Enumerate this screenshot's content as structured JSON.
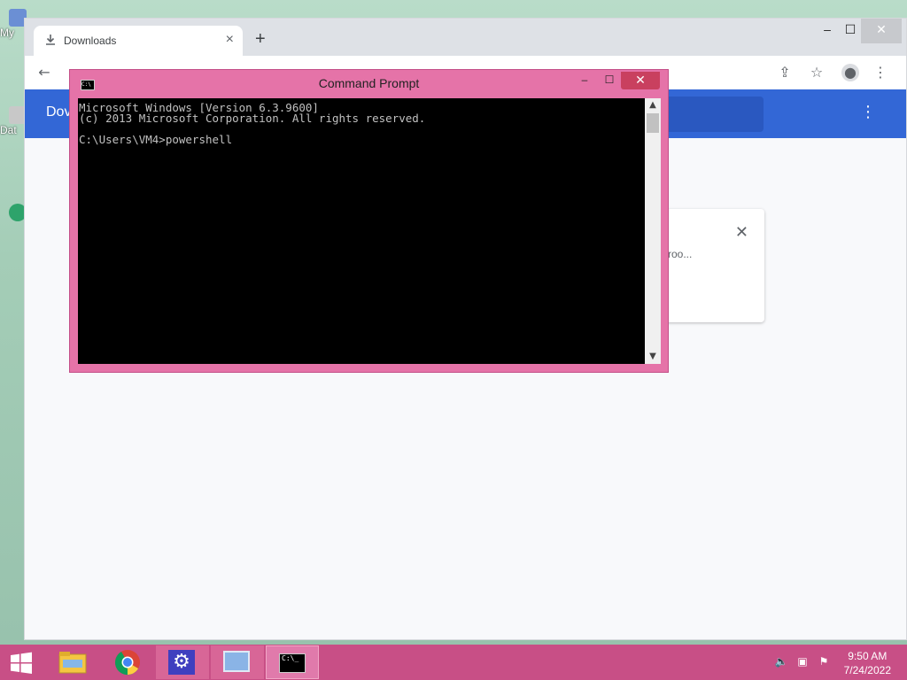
{
  "desktop": {
    "icons": [
      "My",
      "Dat"
    ]
  },
  "chrome": {
    "tab_title": "Downloads",
    "new_tab_label": "+",
    "window_controls": {
      "minimize": "–",
      "maximize": "☐",
      "close": "✕"
    },
    "app_title": "Dov",
    "card_text": "roo...",
    "card_close": "✕",
    "menu_dots": "⋮"
  },
  "cmd": {
    "title": "Command Prompt",
    "controls": {
      "minimize": "–",
      "maximize": "☐",
      "close": "✕"
    },
    "console_text": "Microsoft Windows [Version 6.3.9600]\n(c) 2013 Microsoft Corporation. All rights reserved.\n\nC:\\Users\\VM4>powershell"
  },
  "taskbar": {
    "apps": [
      "start",
      "file-explorer",
      "chrome",
      "settings",
      "control-panel",
      "command-prompt"
    ],
    "clock": {
      "time": "9:50 AM",
      "date": "7/24/2022"
    }
  },
  "colors": {
    "accent": "#c84f86",
    "chrome_appbar": "#3367d6",
    "cmd_frame": "#e573a8"
  }
}
